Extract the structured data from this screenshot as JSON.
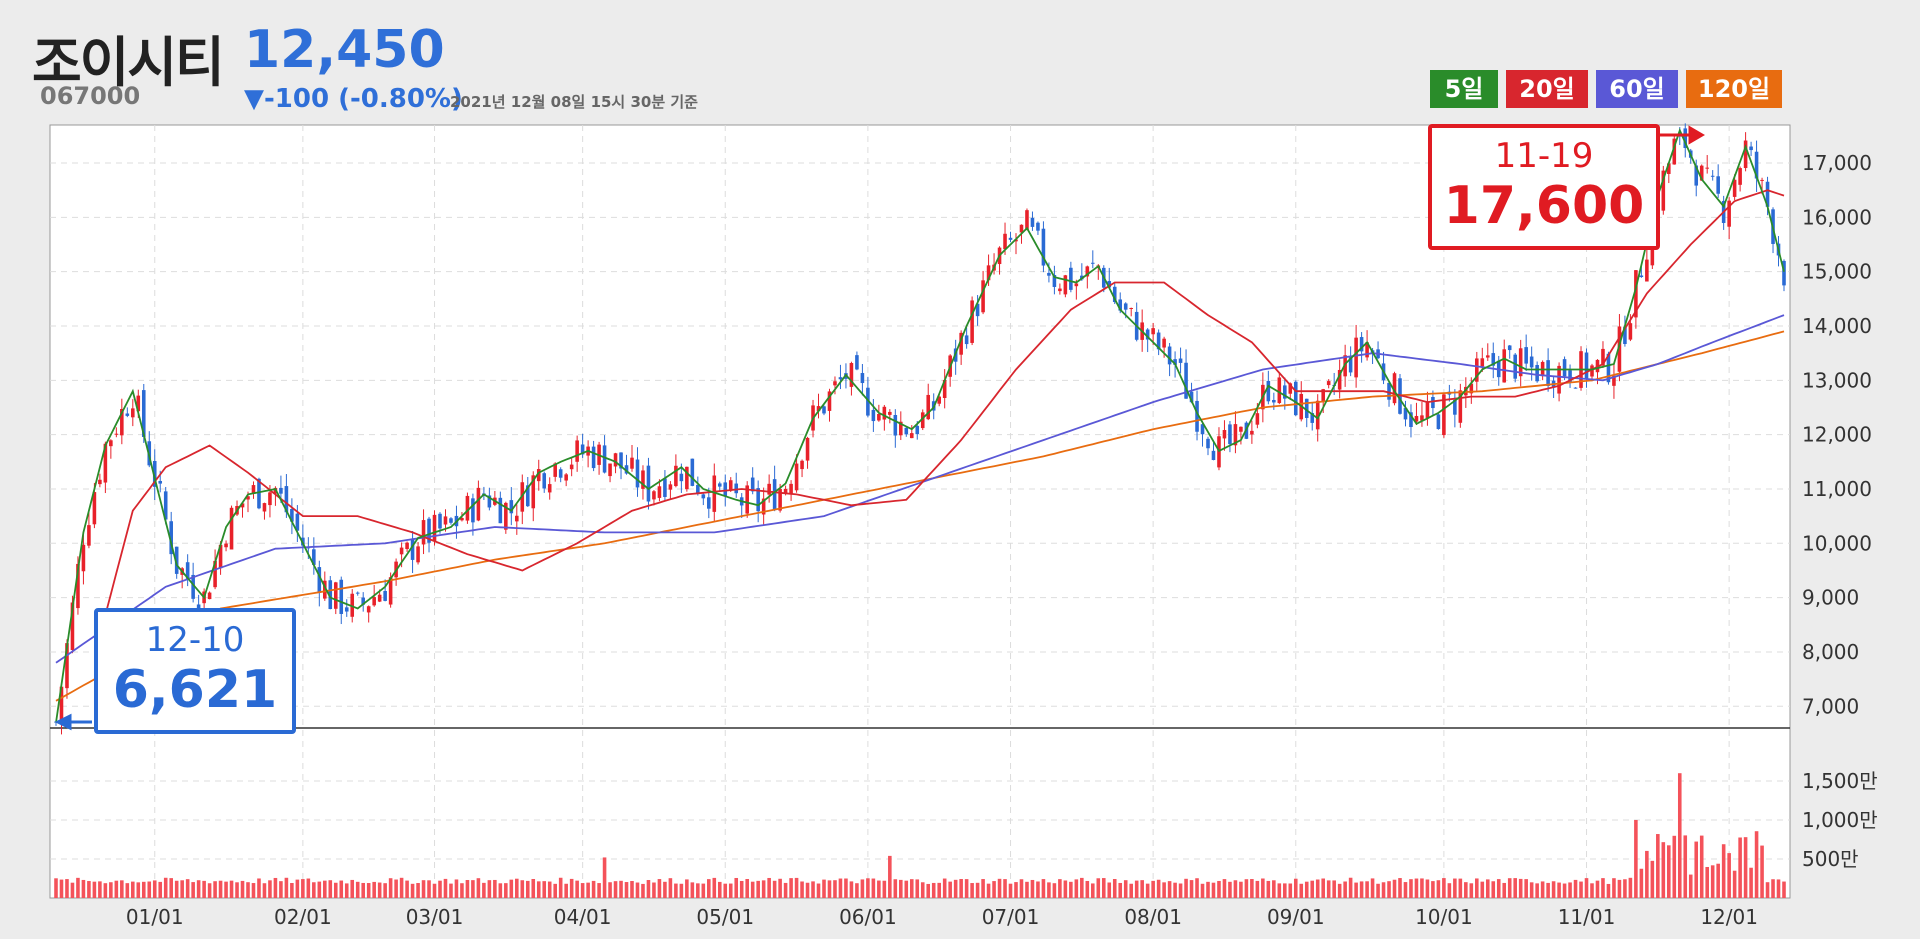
{
  "stock": {
    "name": "조이시티",
    "code": "067000",
    "price": "12,450",
    "change": "▼-100 (-0.80%)",
    "timestamp": "2021년 12월 08일 15시 30분 기준"
  },
  "legend": [
    {
      "label": "5일",
      "color": "#2a8c2a"
    },
    {
      "label": "20일",
      "color": "#d8262e"
    },
    {
      "label": "60일",
      "color": "#5a58d6"
    },
    {
      "label": "120일",
      "color": "#e86c10"
    }
  ],
  "colors": {
    "up": "#e8212a",
    "down": "#2a6ad4",
    "volume": "#f4525a"
  },
  "chart_data": {
    "type": "candlestick",
    "x_ticks": [
      "01/01",
      "02/01",
      "03/01",
      "04/01",
      "05/01",
      "06/01",
      "07/01",
      "08/01",
      "09/01",
      "10/01",
      "11/01",
      "12/01"
    ],
    "price_ticks": [
      "17,000",
      "16,000",
      "15,000",
      "14,000",
      "13,000",
      "12,000",
      "11,000",
      "10,000",
      "9,000",
      "8,000",
      "7,000"
    ],
    "price_range": [
      6600,
      17700
    ],
    "volume_ticks": [
      "1,500만",
      "1,000만",
      "500만"
    ],
    "volume_range_10k": [
      0,
      2000
    ],
    "high": {
      "date": "11-19",
      "value": "17,600"
    },
    "low": {
      "date": "12-10",
      "value": "6,621"
    },
    "moving_averages": [
      "5일",
      "20일",
      "60일",
      "120일"
    ],
    "ma5_keypoints": [
      [
        0,
        6700
      ],
      [
        5,
        10200
      ],
      [
        9,
        11800
      ],
      [
        14,
        12800
      ],
      [
        18,
        11200
      ],
      [
        22,
        9600
      ],
      [
        27,
        9000
      ],
      [
        31,
        10300
      ],
      [
        35,
        10900
      ],
      [
        40,
        11000
      ],
      [
        45,
        10000
      ],
      [
        50,
        9000
      ],
      [
        55,
        8800
      ],
      [
        60,
        9200
      ],
      [
        66,
        10100
      ],
      [
        72,
        10300
      ],
      [
        78,
        10900
      ],
      [
        83,
        10600
      ],
      [
        88,
        11300
      ],
      [
        92,
        11500
      ],
      [
        97,
        11700
      ],
      [
        102,
        11500
      ],
      [
        108,
        11000
      ],
      [
        114,
        11400
      ],
      [
        118,
        11000
      ],
      [
        124,
        10800
      ],
      [
        128,
        10700
      ],
      [
        133,
        11100
      ],
      [
        138,
        12300
      ],
      [
        144,
        13100
      ],
      [
        150,
        12400
      ],
      [
        156,
        12100
      ],
      [
        160,
        12500
      ],
      [
        166,
        14000
      ],
      [
        172,
        15300
      ],
      [
        177,
        15800
      ],
      [
        182,
        14900
      ],
      [
        186,
        14800
      ],
      [
        190,
        15100
      ],
      [
        194,
        14300
      ],
      [
        198,
        13900
      ],
      [
        204,
        13300
      ],
      [
        208,
        12400
      ],
      [
        212,
        11700
      ],
      [
        216,
        11900
      ],
      [
        221,
        12900
      ],
      [
        226,
        12600
      ],
      [
        230,
        12300
      ],
      [
        235,
        13300
      ],
      [
        239,
        13700
      ],
      [
        244,
        12800
      ],
      [
        248,
        12200
      ],
      [
        252,
        12400
      ],
      [
        256,
        12700
      ],
      [
        260,
        13200
      ],
      [
        264,
        13400
      ],
      [
        268,
        13200
      ],
      [
        272,
        13200
      ],
      [
        276,
        13200
      ],
      [
        280,
        13200
      ],
      [
        284,
        13300
      ],
      [
        288,
        14700
      ],
      [
        292,
        16400
      ],
      [
        296,
        17600
      ],
      [
        300,
        16700
      ],
      [
        304,
        16200
      ],
      [
        308,
        17300
      ],
      [
        312,
        16200
      ],
      [
        315,
        15000
      ]
    ],
    "ma20_keypoints": [
      [
        8,
        8300
      ],
      [
        14,
        10600
      ],
      [
        20,
        11400
      ],
      [
        28,
        11800
      ],
      [
        35,
        11300
      ],
      [
        45,
        10500
      ],
      [
        55,
        10500
      ],
      [
        65,
        10200
      ],
      [
        75,
        9800
      ],
      [
        85,
        9500
      ],
      [
        95,
        10000
      ],
      [
        105,
        10600
      ],
      [
        115,
        10900
      ],
      [
        125,
        11000
      ],
      [
        135,
        10900
      ],
      [
        145,
        10700
      ],
      [
        155,
        10800
      ],
      [
        165,
        11900
      ],
      [
        175,
        13200
      ],
      [
        185,
        14300
      ],
      [
        193,
        14800
      ],
      [
        202,
        14800
      ],
      [
        210,
        14200
      ],
      [
        218,
        13700
      ],
      [
        226,
        12800
      ],
      [
        234,
        12800
      ],
      [
        242,
        12800
      ],
      [
        250,
        12600
      ],
      [
        258,
        12700
      ],
      [
        266,
        12700
      ],
      [
        274,
        12900
      ],
      [
        282,
        13300
      ],
      [
        290,
        14600
      ],
      [
        298,
        15500
      ],
      [
        306,
        16300
      ],
      [
        312,
        16500
      ],
      [
        315,
        16400
      ]
    ],
    "ma60_keypoints": [
      [
        0,
        7800
      ],
      [
        20,
        9200
      ],
      [
        40,
        9900
      ],
      [
        60,
        10000
      ],
      [
        80,
        10300
      ],
      [
        100,
        10200
      ],
      [
        120,
        10200
      ],
      [
        140,
        10500
      ],
      [
        160,
        11200
      ],
      [
        180,
        11900
      ],
      [
        200,
        12600
      ],
      [
        220,
        13200
      ],
      [
        240,
        13500
      ],
      [
        256,
        13300
      ],
      [
        270,
        13100
      ],
      [
        282,
        13000
      ],
      [
        292,
        13300
      ],
      [
        302,
        13700
      ],
      [
        315,
        14200
      ]
    ],
    "ma120_keypoints": [
      [
        0,
        7100
      ],
      [
        30,
        8800
      ],
      [
        60,
        9300
      ],
      [
        80,
        9700
      ],
      [
        100,
        10000
      ],
      [
        120,
        10400
      ],
      [
        140,
        10800
      ],
      [
        160,
        11200
      ],
      [
        180,
        11600
      ],
      [
        200,
        12100
      ],
      [
        220,
        12500
      ],
      [
        240,
        12700
      ],
      [
        260,
        12800
      ],
      [
        280,
        13000
      ],
      [
        300,
        13500
      ],
      [
        315,
        13900
      ]
    ]
  }
}
